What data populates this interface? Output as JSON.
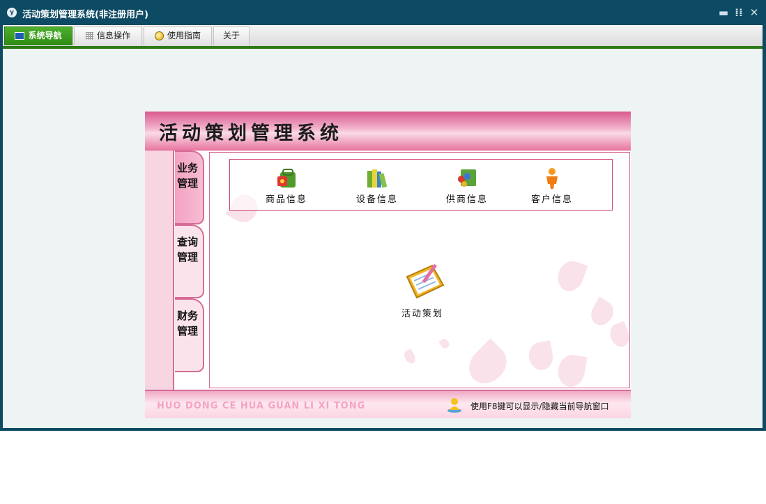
{
  "window": {
    "title": "活动策划管理系统(非注册用户)",
    "app_icon_glyph": "y",
    "controls": {
      "minimize": "▬",
      "restore": "⁞⁞",
      "close": "✕"
    }
  },
  "menu": {
    "tabs": [
      {
        "label": "系统导航",
        "icon": "monitor-icon",
        "active": true
      },
      {
        "label": "信息操作",
        "icon": "grid-icon",
        "active": false
      },
      {
        "label": "使用指南",
        "icon": "help-icon",
        "active": false
      },
      {
        "label": "关于",
        "icon": "",
        "active": false
      }
    ],
    "accent_color": "#2c7a15"
  },
  "panel": {
    "title": "活动策划管理系统",
    "side_tabs": [
      {
        "label": "业务管理",
        "active": true
      },
      {
        "label": "查询管理",
        "active": false
      },
      {
        "label": "财务管理",
        "active": false
      }
    ],
    "quick_items": [
      {
        "label": "商品信息",
        "icon": "product-bag-icon"
      },
      {
        "label": "设备信息",
        "icon": "equipment-books-icon"
      },
      {
        "label": "供商信息",
        "icon": "supplier-icon"
      },
      {
        "label": "客户信息",
        "icon": "customer-person-icon"
      }
    ],
    "main_item": {
      "label": "活动策划",
      "icon": "notepad-pen-icon"
    },
    "footer": {
      "pinyin": "HUO DONG CE HUA GUAN LI XI TONG",
      "hint": "使用F8键可以显示/隐藏当前导航窗口",
      "hint_icon": "user-hint-icon"
    },
    "theme_color": "#d56c95"
  }
}
